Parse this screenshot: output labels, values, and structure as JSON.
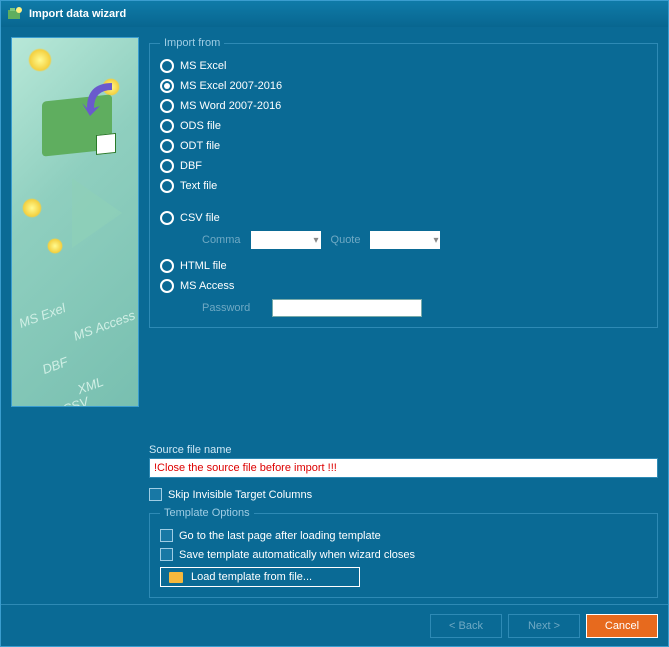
{
  "window": {
    "title": "Import data wizard"
  },
  "importFrom": {
    "legend": "Import from",
    "options": {
      "excel": "MS Excel",
      "excel2007": "MS Excel 2007-2016",
      "word2007": "MS Word 2007-2016",
      "ods": "ODS file",
      "odt": "ODT file",
      "dbf": "DBF",
      "text": "Text file",
      "csv": "CSV file",
      "html": "HTML file",
      "access": "MS Access"
    },
    "selected": "excel2007",
    "csv": {
      "commaLabel": "Comma",
      "quoteLabel": "Quote"
    },
    "access": {
      "passwordLabel": "Password",
      "passwordValue": ""
    }
  },
  "sourceFile": {
    "label": "Source file name",
    "value": "!Close the source file before import !!!"
  },
  "skipInvisible": {
    "label": "Skip Invisible Target Columns",
    "checked": false
  },
  "templateOptions": {
    "legend": "Template Options",
    "goLast": {
      "label": "Go to the last page after loading template",
      "checked": false
    },
    "autoSave": {
      "label": "Save template automatically when wizard closes",
      "checked": false
    },
    "loadBtn": "Load template from file..."
  },
  "footer": {
    "back": "< Back",
    "next": "Next >",
    "cancel": "Cancel"
  },
  "illustration": {
    "labels": [
      "MS Exel",
      "MS Access",
      "DBF",
      "XML",
      "CSV"
    ]
  }
}
